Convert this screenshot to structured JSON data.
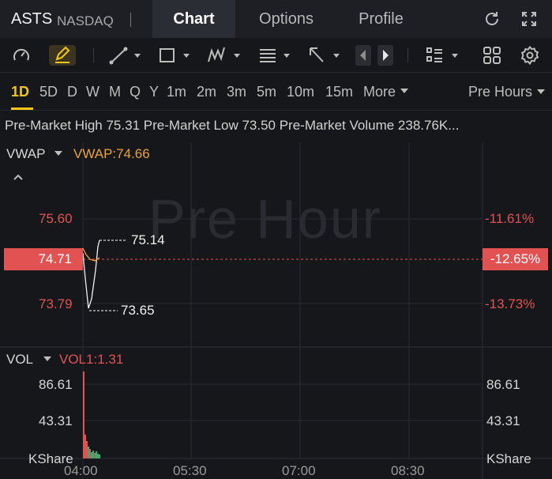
{
  "header": {
    "symbol": "ASTS",
    "exchange": "NASDAQ",
    "tabs": [
      {
        "label": "Chart",
        "active": true
      },
      {
        "label": "Options",
        "active": false
      },
      {
        "label": "Profile",
        "active": false
      }
    ],
    "icons": [
      "refresh-icon",
      "fullscreen-icon"
    ]
  },
  "toolbar": {
    "icons": [
      "gauge-icon",
      "draw-pen-icon",
      "trendline-icon",
      "rectangle-icon",
      "pattern-icon",
      "fib-icon",
      "arrow-icon",
      "prev-icon",
      "next-icon",
      "layout-list-icon",
      "grid-icon",
      "settings-icon"
    ]
  },
  "periods": {
    "items": [
      "1D",
      "5D",
      "D",
      "W",
      "M",
      "Q",
      "Y",
      "1m",
      "2m",
      "3m",
      "5m",
      "10m",
      "15m",
      "More"
    ],
    "active": "1D",
    "session": "Pre Hours"
  },
  "info": {
    "text": "Pre-Market High 75.31 Pre-Market Low 73.50 Pre-Market Volume 238.76K..."
  },
  "price_panel": {
    "indicator": "VWAP",
    "indicator_value": "VWAP:74.66",
    "watermark": "Pre Hour",
    "levels_left": [
      "75.60",
      "74.71",
      "73.79"
    ],
    "levels_right": [
      "-11.61%",
      "-12.65%",
      "-13.73%"
    ],
    "high_marker": "75.14",
    "low_marker": "73.65",
    "current_price": "74.71",
    "current_pct": "-12.65%"
  },
  "volume_panel": {
    "indicator": "VOL",
    "indicator_value": "VOL1:1.31",
    "levels_left": [
      "86.61",
      "43.31"
    ],
    "levels_right": [
      "86.61",
      "43.31"
    ],
    "unit": "KShare"
  },
  "time_axis": [
    "04:00",
    "05:30",
    "07:00",
    "08:30"
  ],
  "colors": {
    "accent": "#f5c518",
    "down": "#e25252",
    "up": "#26b574",
    "vwap": "#e8a33d"
  }
}
